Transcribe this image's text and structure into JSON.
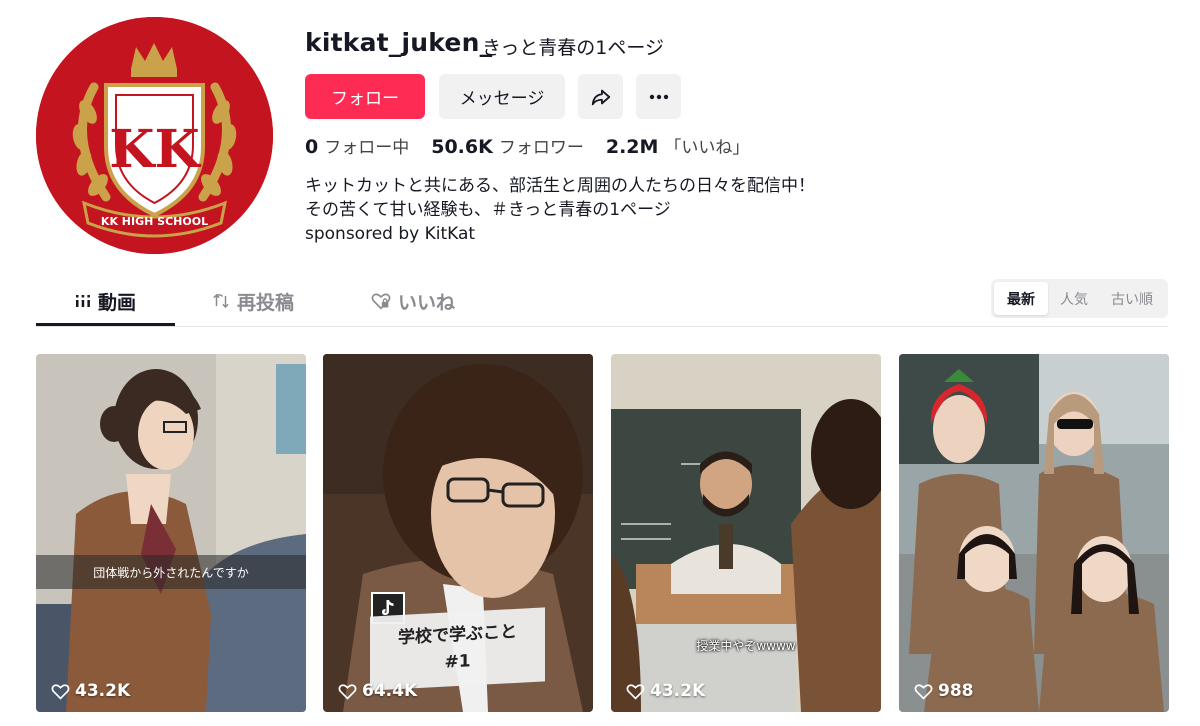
{
  "profile": {
    "username": "kitkat_juken_",
    "nickname": "きっと青春の1ページ",
    "avatar": {
      "crest_text": "KK HIGH SCHOOL",
      "crest_letters": "KK"
    },
    "follow_label": "フォロー",
    "message_label": "メッセージ",
    "share_icon": "share-icon",
    "more_icon": "more-icon",
    "stats": [
      {
        "value": "0",
        "label": "フォロー中"
      },
      {
        "value": "50.6K",
        "label": "フォロワー"
      },
      {
        "value": "2.2M",
        "label": "「いいね」"
      }
    ],
    "bio": [
      "キットカットと共にある、部活生と周囲の人たちの日々を配信中！",
      "その苦くて甘い経験も、＃きっと青春の1ページ",
      "sponsored by KitKat"
    ]
  },
  "tabs": [
    {
      "label": "動画",
      "icon": "grid-icon",
      "active": true
    },
    {
      "label": "再投稿",
      "icon": "repost-icon",
      "active": false
    },
    {
      "label": "いいね",
      "icon": "heart-lock-icon",
      "active": false
    }
  ],
  "sort": {
    "options": [
      "最新",
      "人気",
      "古い順"
    ],
    "selected": "最新"
  },
  "videos": [
    {
      "likes": "43.2K",
      "overlay_text": "団体戦から外されたんですか"
    },
    {
      "likes": "64.4K",
      "overlay_lines": [
        "学校で学ぶこと",
        "#1"
      ]
    },
    {
      "likes": "43.2K",
      "subtitle": "授業中やぞwwww"
    },
    {
      "likes": "988"
    }
  ],
  "colors": {
    "accent": "#fe2c55",
    "avatar_bg": "#c4141f",
    "crest_gold": "#c9a24a"
  }
}
